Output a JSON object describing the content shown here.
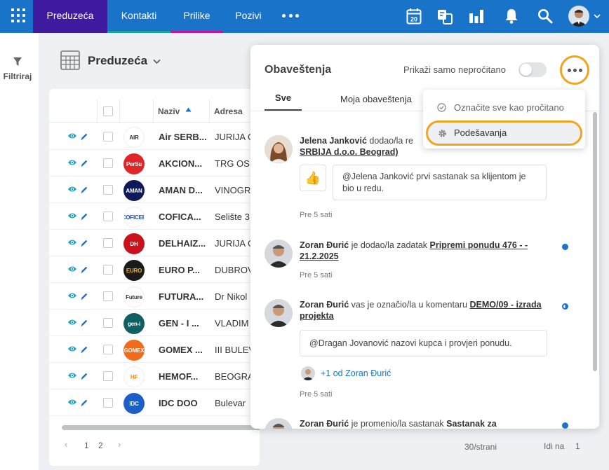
{
  "topnav": {
    "tabs": [
      {
        "label": "Preduzeća",
        "underline": "#3f1a9e"
      },
      {
        "label": "Kontakti",
        "underline": "#1aa39a"
      },
      {
        "label": "Prilike",
        "underline": "#c0169e"
      },
      {
        "label": "Pozivi",
        "underline": ""
      }
    ],
    "calendar_day": "20",
    "icons": [
      "apps-grid-icon",
      "more-dots-icon",
      "calendar-icon",
      "exchange-icon",
      "chart-bar-icon",
      "bell-icon",
      "search-icon",
      "user-avatar"
    ]
  },
  "sidebar": {
    "filter_label": "Filtriraj"
  },
  "page": {
    "title": "Preduzeća"
  },
  "table": {
    "columns": {
      "name": "Naziv",
      "address": "Adresa"
    },
    "rows": [
      {
        "name": "Air SERB...",
        "address": "JURIJA G",
        "logo_text": "AIR",
        "logo_bg": "#ffffff",
        "logo_fg": "#333333"
      },
      {
        "name": "AKCION...",
        "address": "TRG OSL",
        "logo_text": "PerSu",
        "logo_bg": "#e02529",
        "logo_fg": "#ffffff"
      },
      {
        "name": "AMAN D...",
        "address": "VINOGR",
        "logo_text": "AMAN",
        "logo_bg": "#101a5a",
        "logo_fg": "#ffffff"
      },
      {
        "name": "COFICA...",
        "address": "Selište 3",
        "logo_text": "COFICEB",
        "logo_bg": "#ffffff",
        "logo_fg": "#1a4aa0"
      },
      {
        "name": "DELHAIZ...",
        "address": "JURIJA G",
        "logo_text": "DH",
        "logo_bg": "#c9121b",
        "logo_fg": "#ffffff"
      },
      {
        "name": "EURO P...",
        "address": "DUBROV",
        "logo_text": "EURO",
        "logo_bg": "#1a1a1a",
        "logo_fg": "#f3b515"
      },
      {
        "name": "FUTURA...",
        "address": "Dr Nikol",
        "logo_text": "Future",
        "logo_bg": "#ffffff",
        "logo_fg": "#333333"
      },
      {
        "name": "GEN - I ...",
        "address": "VLADIM",
        "logo_text": "gen-i",
        "logo_bg": "#0f5f63",
        "logo_fg": "#ffffff"
      },
      {
        "name": "GOMEX ...",
        "address": "III BULEV",
        "logo_text": "GOMEX",
        "logo_bg": "#f26b1d",
        "logo_fg": "#ffffff"
      },
      {
        "name": "HEMOF...",
        "address": "BEOGRA",
        "logo_text": "HF",
        "logo_bg": "#ffffff",
        "logo_fg": "#f08a24"
      },
      {
        "name": "IDC DOO",
        "address": "Bulevar",
        "logo_text": "IDC",
        "logo_bg": "#1d5fc9",
        "logo_fg": "#ffffff"
      }
    ]
  },
  "pagination": {
    "prev": "‹",
    "pages": [
      "1",
      "2"
    ],
    "next": "›",
    "per_page": "30/strani",
    "goto_label": "Idi na",
    "goto_value": "1"
  },
  "notifications": {
    "title": "Obaveštenja",
    "unread_only_label": "Prikaži samo nepročitano",
    "unread_only_on": false,
    "tabs": [
      "Sve",
      "Moja obaveštenja"
    ],
    "menu": {
      "mark_all_read": "Označite sve kao pročitano",
      "settings": "Podešavanja"
    },
    "items": [
      {
        "actor": "Jelena Janković",
        "action": " dodao/la re",
        "link": "SRBIJA d.o.o. Beograd)",
        "comment": "@Jelena Janković prvi sastanak sa klijentom je bio u redu.",
        "reaction": "👍",
        "time": "Pre 5 sati",
        "status": "none"
      },
      {
        "actor": "Zoran Đurić",
        "action": " je dodao/la zadatak ",
        "link": "Pripremi ponudu 476 - - 21.2.2025",
        "time": "Pre 5 sati",
        "status": "unread"
      },
      {
        "actor": "Zoran Đurić",
        "action": " vas je označio/la u komentaru ",
        "link": "DEMO/09 - izrada projekta",
        "comment": "@Dragan Jovanović nazovi kupca i provjeri ponudu.",
        "more_replies": "+1 od Zoran Đurić",
        "time": "Pre 5 sati",
        "status": "partial"
      },
      {
        "actor": "Zoran Đurić",
        "action": " je promenio/la sastanak ",
        "link": "Sastanak za",
        "status": "unread"
      }
    ]
  }
}
